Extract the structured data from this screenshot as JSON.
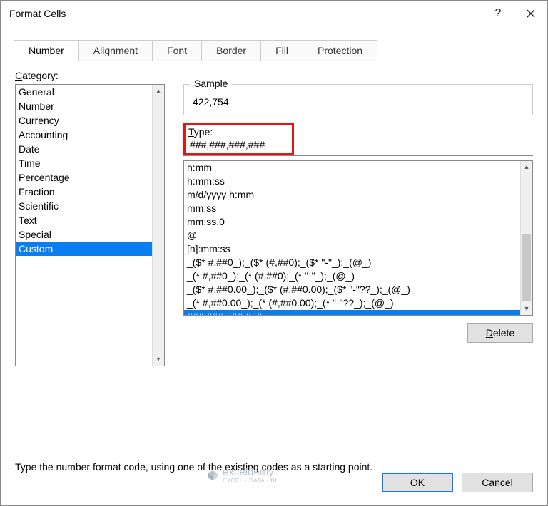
{
  "title": "Format Cells",
  "tabs": [
    "Number",
    "Alignment",
    "Font",
    "Border",
    "Fill",
    "Protection"
  ],
  "active_tab": 0,
  "category_label": "Category:",
  "categories": [
    "General",
    "Number",
    "Currency",
    "Accounting",
    "Date",
    "Time",
    "Percentage",
    "Fraction",
    "Scientific",
    "Text",
    "Special",
    "Custom"
  ],
  "category_selected": 11,
  "sample": {
    "legend": "Sample",
    "value": "422,754"
  },
  "type": {
    "label": "Type:",
    "value": "###,###,###,###"
  },
  "formats": [
    "h:mm",
    "h:mm:ss",
    "m/d/yyyy h:mm",
    "mm:ss",
    "mm:ss.0",
    "@",
    "[h]:mm:ss",
    "_($* #,##0_);_($* (#,##0);_($* \"-\"_);_(@_)",
    "_(* #,##0_);_(* (#,##0);_(* \"-\"_);_(@_)",
    "_($* #,##0.00_);_($* (#,##0.00);_($* \"-\"??_);_(@_)",
    "_(* #,##0.00_);_(* (#,##0.00);_(* \"-\"??_);_(@_)",
    "###,###,###,###"
  ],
  "format_selected": 11,
  "delete_label": "Delete",
  "hint": "Type the number format code, using one of the existing codes as a starting point.",
  "ok_label": "OK",
  "cancel_label": "Cancel",
  "watermark": {
    "brand": "exceldemy",
    "tagline": "EXCEL · DATA · BI"
  }
}
